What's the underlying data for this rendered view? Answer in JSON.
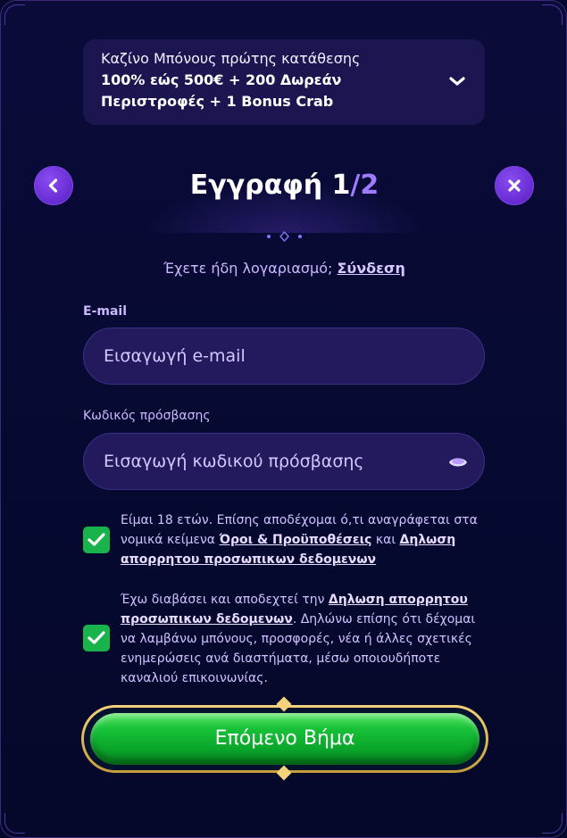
{
  "bonus": {
    "title": "Καζίνο Μπόνους πρώτης κατάθεσης",
    "offer": "100% εώς 500€ + 200 Δωρεάν Περιστροφές + 1 Bonus Crab",
    "icon": "chevron-down-icon"
  },
  "header": {
    "title_prefix": "Εγγραφή 1",
    "title_slash": "/",
    "title_total": "2",
    "back_icon": "chevron-left-icon",
    "close_icon": "close-icon"
  },
  "login": {
    "prompt": "Έχετε ήδη λογαριασμό; ",
    "link": "Σύνδεση"
  },
  "email": {
    "label": "E-mail",
    "placeholder": "Εισαγωγή e-mail",
    "value": ""
  },
  "password": {
    "label": "Κωδικός πρόσβασης",
    "placeholder": "Εισαγωγή κωδικού πρόσβασης",
    "value": "",
    "icon": "eye-icon"
  },
  "consent_terms": {
    "checked": true,
    "text_1": "Είμαι 18 ετών. Επίσης αποδέχομαι ό,τι αναγράφεται στα νομικά κείμενα ",
    "link_terms": "Όροι & Προϋποθέσεις",
    "text_2": " και ",
    "link_privacy": "Δηλωση απορρητου προσωπικων δεδομενων"
  },
  "consent_marketing": {
    "checked": true,
    "text_1": "Έχω διαβάσει και αποδεχτεί την ",
    "link_privacy": "Δηλωση απορρητου προσωπικων δεδομενων",
    "text_2": ". Δηλώνω επίσης ότι δέχομαι να λαμβάνω μπόνους, προσφορές, νέα ή άλλες σχετικές ενημερώσεις ανά διαστήματα, μέσω οποιουδήποτε καναλιού επικοινωνίας."
  },
  "cta": {
    "label": "Επόμενο Βήμα"
  },
  "colors": {
    "background": "#05082a",
    "accent": "#9e7bff",
    "cta_green": "#18c238",
    "checkbox_green": "#18b34a",
    "gold_frame": "#f2d27a"
  }
}
